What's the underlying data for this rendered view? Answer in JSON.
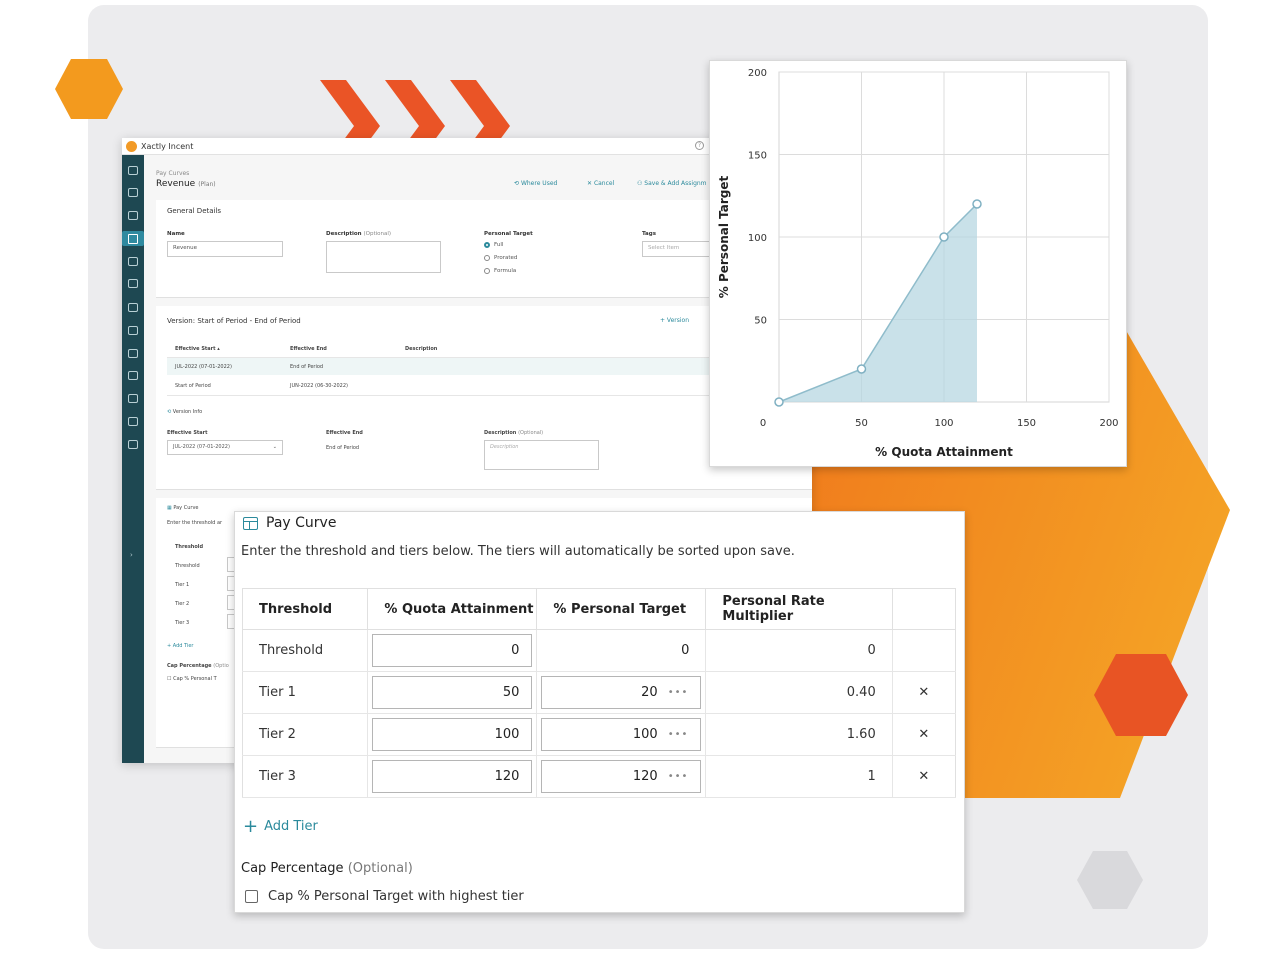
{
  "app": {
    "name": "Xactly Incent",
    "breadcrumb": "Pay Curves",
    "title": "Revenue",
    "title_tag": "(Plan)",
    "actions": {
      "where_used": "Where Used",
      "cancel": "Cancel",
      "save_add": "Save & Add Assignm"
    },
    "general": {
      "heading": "General Details",
      "name_label": "Name",
      "name_value": "Revenue",
      "desc_label": "Description",
      "desc_optional": "(Optional)",
      "target_label": "Personal Target",
      "target_options": [
        "Full",
        "Prorated",
        "Formula"
      ],
      "tags_label": "Tags",
      "tags_placeholder": "Select Item"
    },
    "version": {
      "heading": "Version: Start of Period - End of Period",
      "add_version": "+ Version",
      "columns": [
        "Effective Start",
        "Effective End",
        "Description"
      ],
      "rows": [
        [
          "JUL-2022 (07-01-2022)",
          "End of Period",
          ""
        ],
        [
          "Start of Period",
          "JUN-2022 (06-30-2022)",
          ""
        ]
      ],
      "info_label": "Version Info",
      "eff_start_label": "Effective Start",
      "eff_start_value": "JUL-2022 (07-01-2022)",
      "eff_end_label": "Effective End",
      "eff_end_value": "End of Period",
      "desc_label": "Description",
      "desc_optional": "(Optional)",
      "desc_placeholder": "Description"
    },
    "paycurve_mini": {
      "heading": "Pay Curve",
      "text": "Enter the threshold ar",
      "col": "Threshold",
      "rows": [
        "Threshold",
        "Tier 1",
        "Tier 2",
        "Tier 3"
      ],
      "add": "+ Add Tier",
      "cap": "Cap Percentage",
      "cap_opt": "(Optio",
      "cap_chk": "Cap % Personal T"
    }
  },
  "chart_data": {
    "type": "area",
    "x": [
      0,
      50,
      100,
      120
    ],
    "y": [
      0,
      20,
      100,
      120
    ],
    "xlabel": "% Quota Attainment",
    "ylabel": "% Personal Target",
    "xlim": [
      0,
      200
    ],
    "ylim": [
      0,
      200
    ],
    "xticks": [
      0,
      50,
      100,
      150,
      200
    ],
    "yticks": [
      50,
      100,
      150,
      200
    ],
    "grid": true,
    "color": "#b7d7e1"
  },
  "pay_curve": {
    "title": "Pay Curve",
    "description": "Enter the threshold and tiers below. The tiers will automatically be sorted upon save.",
    "columns": [
      "Threshold",
      "% Quota Attainment",
      "% Personal Target",
      "Personal Rate Multiplier"
    ],
    "rows": [
      {
        "name": "Threshold",
        "quota": "0",
        "target": "0",
        "multiplier": "0"
      },
      {
        "name": "Tier 1",
        "quota": "50",
        "target": "20",
        "multiplier": "0.40"
      },
      {
        "name": "Tier 2",
        "quota": "100",
        "target": "100",
        "multiplier": "1.60"
      },
      {
        "name": "Tier 3",
        "quota": "120",
        "target": "120",
        "multiplier": "1"
      }
    ],
    "add_tier": "Add Tier",
    "cap_label": "Cap Percentage",
    "cap_optional": "(Optional)",
    "cap_checkbox": "Cap % Personal Target with highest tier"
  },
  "colors": {
    "accent": "#2b8a9c",
    "orange": "#f4841f",
    "red_orange": "#e85424",
    "sidebar": "#1e4852"
  }
}
